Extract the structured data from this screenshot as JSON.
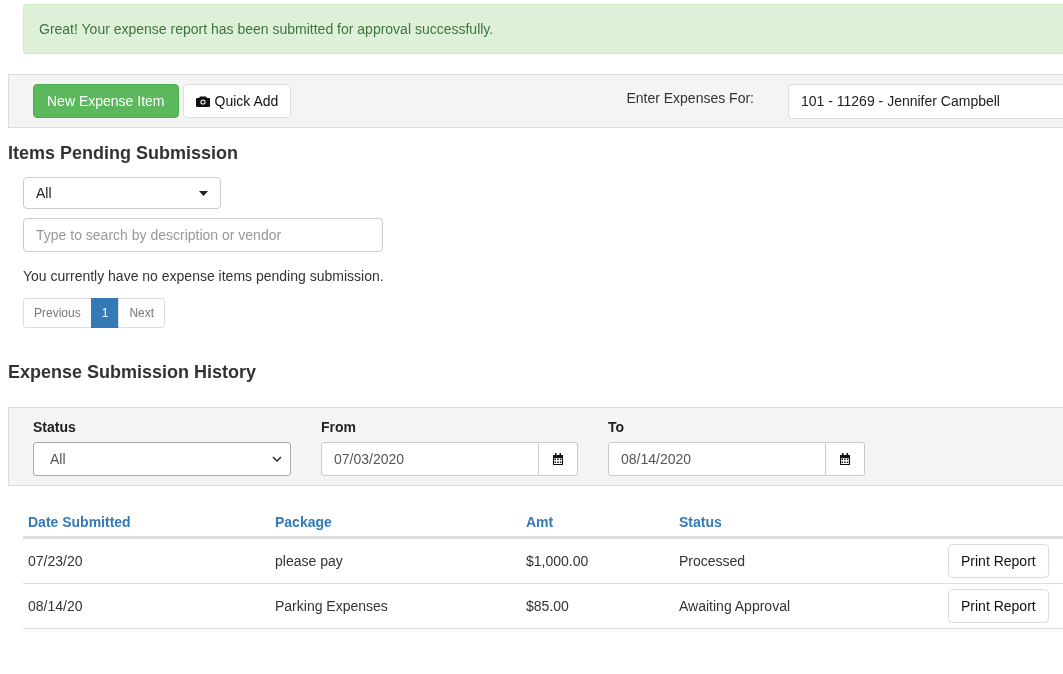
{
  "alert": {
    "message": "Great! Your expense report has been submitted for approval successfully."
  },
  "toolbar": {
    "new_button": "New Expense Item",
    "quick_add_button": "Quick Add",
    "enter_for_label": "Enter Expenses For:",
    "enter_for_value": "101 - 11269 - Jennifer Campbell"
  },
  "pending": {
    "title": "Items Pending Submission",
    "filter": "All",
    "search": {
      "placeholder": "Type to search by description or vendor"
    },
    "empty_message": "You currently have no expense items pending submission.",
    "pagination": {
      "previous": "Previous",
      "pages": [
        {
          "label": "1",
          "selected": true
        }
      ],
      "next": "Next"
    }
  },
  "history": {
    "title": "Expense Submission History",
    "filters": [
      {
        "kind": "select",
        "label": "Status",
        "value": "All"
      },
      {
        "kind": "date",
        "label": "From",
        "value": "07/03/2020"
      },
      {
        "kind": "date",
        "label": "To",
        "value": "08/14/2020"
      }
    ],
    "table": {
      "columns": [
        "Date Submitted",
        "Package",
        "Amt",
        "Status"
      ],
      "rows": [
        {
          "cells": [
            "07/23/20",
            "please pay",
            "$1,000.00",
            "Processed"
          ],
          "action": "Print Report"
        },
        {
          "cells": [
            "08/14/20",
            "Parking Expenses",
            "$85.00",
            "Awaiting Approval"
          ],
          "action": "Print Report"
        }
      ]
    }
  }
}
